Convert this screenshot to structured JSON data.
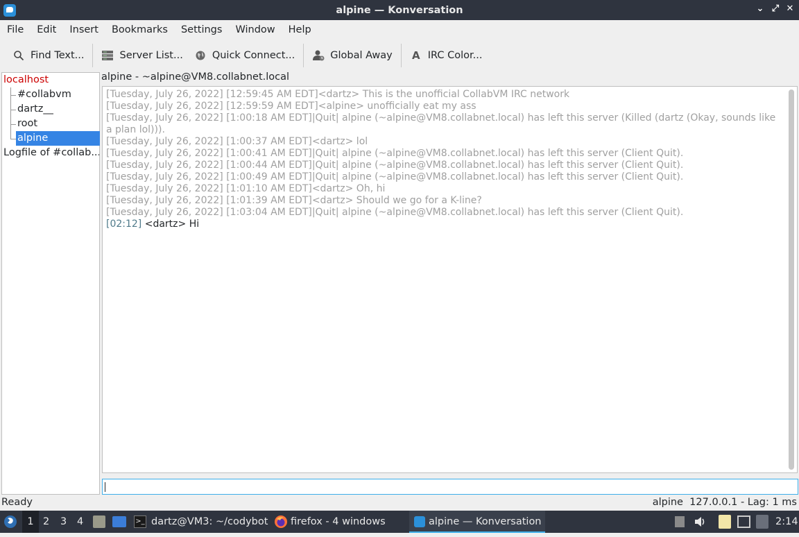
{
  "window": {
    "title": "alpine — Konversation"
  },
  "menu": [
    "File",
    "Edit",
    "Insert",
    "Bookmarks",
    "Settings",
    "Window",
    "Help"
  ],
  "toolbar": {
    "find": "Find Text...",
    "server_list": "Server List...",
    "quick_connect": "Quick Connect...",
    "global_away": "Global Away",
    "irc_color": "IRC Color..."
  },
  "sidebar": {
    "server": "localhost",
    "channels": [
      "#collabvm",
      "dartz__",
      "root",
      "alpine"
    ],
    "selected": "alpine",
    "logfile": "Logfile of #collab..."
  },
  "channel_header": "alpine - ~alpine@VM8.collabnet.local",
  "chat": {
    "old_lines": [
      "[Tuesday, July 26, 2022] [12:59:45 AM EDT]<dartz> This is the unofficial CollabVM IRC network",
      "[Tuesday, July 26, 2022] [12:59:59 AM EDT]<alpine> unofficially eat my ass",
      "[Tuesday, July 26, 2022] [1:00:18 AM EDT]|Quit| alpine (~alpine@VM8.collabnet.local) has left this server (Killed (dartz (Okay, sounds like a plan lol))).",
      "[Tuesday, July 26, 2022] [1:00:37 AM EDT]<dartz> lol",
      "[Tuesday, July 26, 2022] [1:00:41 AM EDT]|Quit| alpine (~alpine@VM8.collabnet.local) has left this server (Client Quit).",
      "[Tuesday, July 26, 2022] [1:00:44 AM EDT]|Quit| alpine (~alpine@VM8.collabnet.local) has left this server (Client Quit).",
      "[Tuesday, July 26, 2022] [1:00:49 AM EDT]|Quit| alpine (~alpine@VM8.collabnet.local) has left this server (Client Quit).",
      "[Tuesday, July 26, 2022] [1:01:10 AM EDT]<dartz> Oh, hi",
      "[Tuesday, July 26, 2022] [1:01:39 AM EDT]<dartz> Should we go for a K-line?",
      "[Tuesday, July 26, 2022] [1:03:04 AM EDT]|Quit| alpine (~alpine@VM8.collabnet.local) has left this server (Client Quit)."
    ],
    "new_timestamp": "[02:12]",
    "new_message": " <dartz> Hi"
  },
  "input": {
    "value": ""
  },
  "status": {
    "left": "Ready",
    "right": "alpine  127.0.0.1 - Lag: 1 ms"
  },
  "taskbar": {
    "desktops": [
      "1",
      "2",
      "3",
      "4"
    ],
    "tasks": [
      "dartz@VM3: ~/codybot",
      "firefox - 4 windows",
      "alpine — Konversation"
    ],
    "clock": "2:14"
  },
  "colors": {
    "accent": "#3daee9",
    "selection": "#3584e4",
    "server": "#cc0000",
    "titlebar": "#2f343f"
  }
}
